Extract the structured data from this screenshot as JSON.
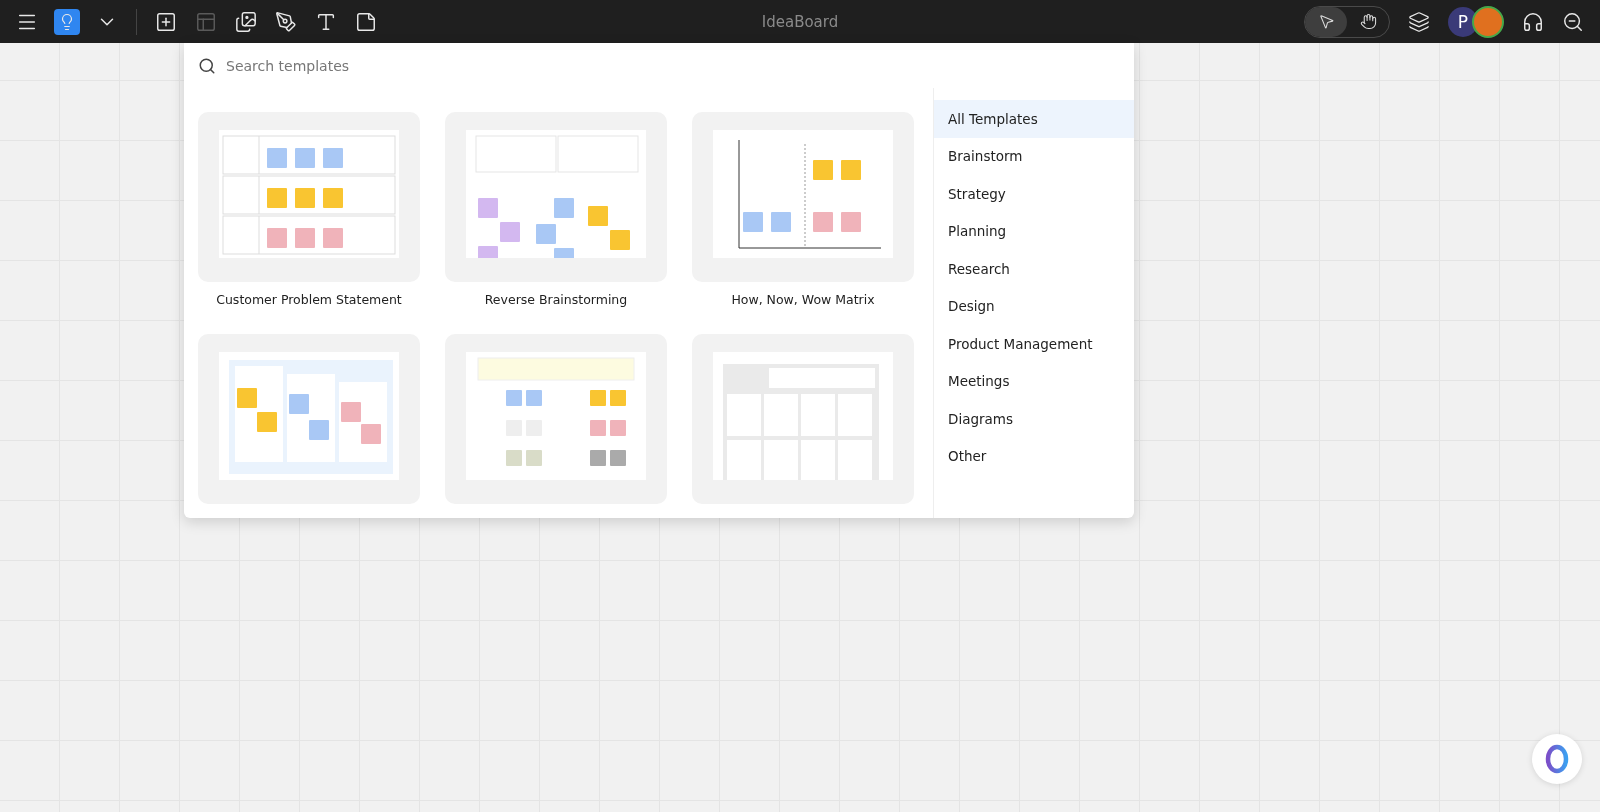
{
  "topbar": {
    "title": "IdeaBoard",
    "tools": [
      {
        "kind": "menu",
        "disabled": false
      },
      {
        "kind": "ideas",
        "disabled": false
      },
      {
        "kind": "dropdown",
        "disabled": false
      },
      {
        "kind": "add",
        "disabled": false
      },
      {
        "kind": "layout",
        "disabled": true
      },
      {
        "kind": "image",
        "disabled": false
      },
      {
        "kind": "pen",
        "disabled": false
      },
      {
        "kind": "text",
        "disabled": false
      },
      {
        "kind": "sticky",
        "disabled": false
      }
    ],
    "modes": [
      {
        "kind": "pointer",
        "selected": true
      },
      {
        "kind": "hand",
        "selected": false
      }
    ],
    "avatar_initial": "P"
  },
  "template_panel": {
    "search": {
      "placeholder": "Search templates"
    },
    "templates": [
      {
        "name": "Customer Problem Statement",
        "kind": "table"
      },
      {
        "name": "Reverse Brainstorming",
        "kind": "scatter"
      },
      {
        "name": "How, Now, Wow Matrix",
        "kind": "matrix"
      },
      {
        "kind": "columns"
      },
      {
        "kind": "hats"
      },
      {
        "kind": "grid"
      }
    ],
    "categories": [
      {
        "label": "All Templates",
        "selected": true
      },
      {
        "label": "Brainstorm",
        "selected": false
      },
      {
        "label": "Strategy",
        "selected": false
      },
      {
        "label": "Planning",
        "selected": false
      },
      {
        "label": "Research",
        "selected": false
      },
      {
        "label": "Design",
        "selected": false
      },
      {
        "label": "Product Management",
        "selected": false
      },
      {
        "label": "Meetings",
        "selected": false
      },
      {
        "label": "Diagrams",
        "selected": false
      },
      {
        "label": "Other",
        "selected": false
      }
    ]
  }
}
